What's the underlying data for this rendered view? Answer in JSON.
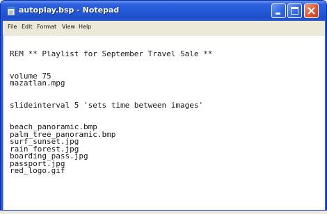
{
  "window": {
    "title": "autoplay.bsp - Notepad"
  },
  "menu": {
    "items": [
      "File",
      "Edit",
      "Format",
      "View",
      "Help"
    ]
  },
  "editor": {
    "lines": [
      "REM ** Playlist for September Travel Sale **",
      "",
      "",
      "volume 75",
      "mazatlan.mpg",
      "",
      "",
      "slideinterval 5 'sets time between images'",
      "",
      "",
      "beach_panoramic.bmp",
      "palm_tree_panoramic.bmp",
      "surf_sunset.jpg",
      "rain_forest.jpg",
      "boarding_pass.jpg",
      "passport.jpg",
      "red_logo.gif"
    ]
  },
  "colors": {
    "titlebar": "#2458d6",
    "close_button": "#e0562e",
    "menubar": "#ece9d8",
    "editor_background": "#ffffff"
  },
  "icons": [
    "notepad-icon",
    "minimize-icon",
    "maximize-icon",
    "close-icon"
  ]
}
